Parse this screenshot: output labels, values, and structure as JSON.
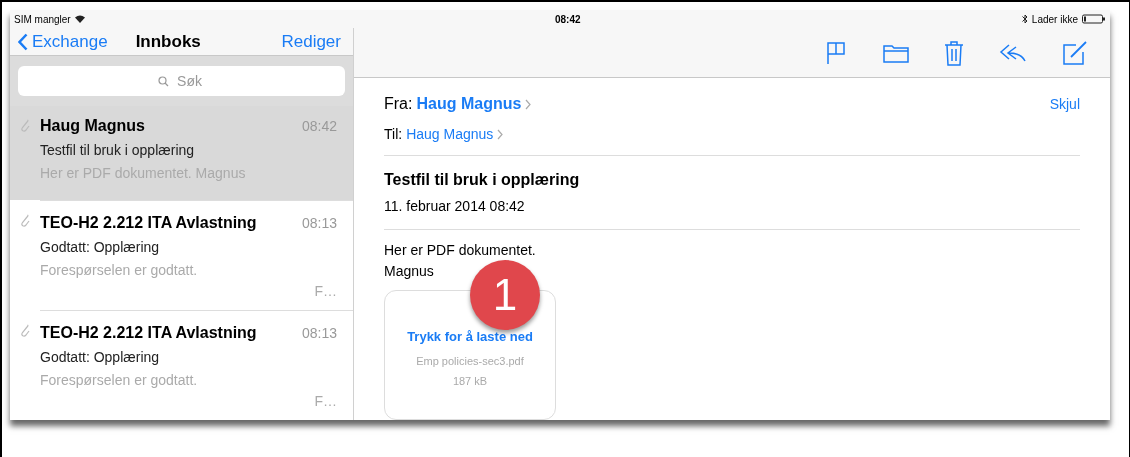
{
  "status_bar": {
    "carrier": "SIM mangler",
    "time": "08:42",
    "charging": "Lader ikke"
  },
  "sidebar": {
    "back": "Exchange",
    "title": "Innboks",
    "edit": "Rediger",
    "search": {
      "placeholder": "Søk"
    },
    "messages": [
      {
        "sender": "Haug Magnus",
        "time": "08:42",
        "subject": "Testfil til bruk i opplæring",
        "preview": "Her er PDF dokumentet. Magnus",
        "attachment": true,
        "selected": true
      },
      {
        "sender": "TEO-H2 2.212 ITA Avlastning",
        "time": "08:13",
        "subject": "Godtatt: Opplæring",
        "preview": "Forespørselen er godtatt.",
        "preview_more": "F…",
        "attachment": true,
        "selected": false
      },
      {
        "sender": "TEO-H2 2.212 ITA Avlastning",
        "time": "08:13",
        "subject": "Godtatt: Opplæring",
        "preview": "Forespørselen er godtatt.",
        "preview_more": "F…",
        "attachment": true,
        "selected": false
      }
    ]
  },
  "message": {
    "from_label": "Fra:",
    "from": "Haug Magnus",
    "to_label": "Til:",
    "to": "Haug Magnus",
    "hide": "Skjul",
    "subject": "Testfil til bruk i opplæring",
    "date": "11. februar 2014 08:42",
    "body": [
      "Her er PDF dokumentet.",
      "Magnus"
    ],
    "attachment": {
      "action": "Trykk for å laste ned",
      "filename": "Emp policies-sec3.pdf",
      "size": "187 kB"
    },
    "callout": "1"
  }
}
